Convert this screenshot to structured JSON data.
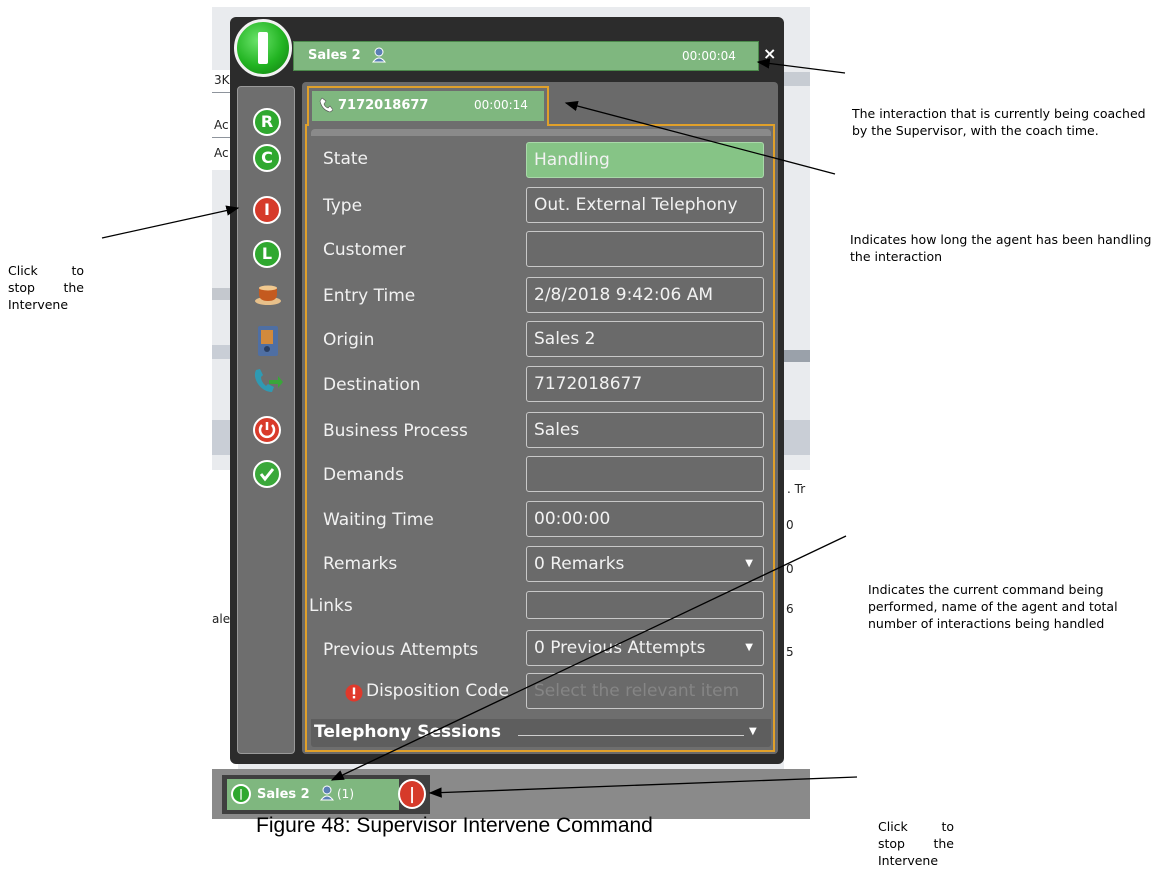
{
  "figure": {
    "caption": "Figure 48: Supervisor Intervene Command"
  },
  "header": {
    "title": "Sales 2",
    "timer": "00:00:04",
    "close_label": "×"
  },
  "interaction_tab": {
    "number": "7172018677",
    "coach_time": "00:00:14"
  },
  "side_buttons": [
    {
      "letter": "R",
      "icon": "ready-icon"
    },
    {
      "letter": "C",
      "icon": "coach-icon"
    },
    {
      "letter": "I",
      "icon": "intervene-icon"
    },
    {
      "letter": "L",
      "icon": "listen-icon"
    },
    {
      "icon": "break-cup-icon"
    },
    {
      "icon": "phone-book-icon"
    },
    {
      "icon": "transfer-phone-icon"
    },
    {
      "icon": "power-icon"
    },
    {
      "icon": "check-icon"
    }
  ],
  "fields": {
    "state": {
      "label": "State",
      "value": "Handling"
    },
    "type": {
      "label": "Type",
      "value": "Out. External Telephony"
    },
    "customer": {
      "label": "Customer",
      "value": ""
    },
    "entry_time": {
      "label": "Entry Time",
      "value": "2/8/2018 9:42:06 AM"
    },
    "origin": {
      "label": "Origin",
      "value": "Sales 2"
    },
    "destination": {
      "label": "Destination",
      "value": "7172018677"
    },
    "business_process": {
      "label": "Business Process",
      "value": "Sales"
    },
    "demands": {
      "label": "Demands",
      "value": ""
    },
    "waiting_time": {
      "label": "Waiting Time",
      "value": "00:00:00"
    },
    "remarks": {
      "label": "Remarks",
      "value": "0 Remarks"
    },
    "links": {
      "label": "Links",
      "value": ""
    },
    "previous_attempts": {
      "label": "Previous Attempts",
      "value": "0 Previous Attempts"
    },
    "disposition_code": {
      "label": "Disposition Code",
      "placeholder": "Select the relevant item"
    }
  },
  "telephony_sessions": {
    "label": "Telephony Sessions"
  },
  "bottom_bar": {
    "agent": "Sales 2",
    "count": "(1)"
  },
  "background_fragments": {
    "left_top": "3K",
    "left_row1": "Ac",
    "left_row2": "Ac",
    "left_row3": "ale",
    "right_header": ". Tr",
    "right_row1": "0",
    "right_row2": "0",
    "right_row3": "6",
    "right_row4": "5"
  },
  "annotations": {
    "coached_interaction": "The interaction that is currently being coached by the Supervisor, with the coach time.",
    "handling_duration": "Indicates how long the agent has been handling the interaction",
    "stop_intervene_left": "Click to stop the Intervene",
    "current_command": "Indicates the current command being performed, name of the agent and total number of interactions being handled",
    "stop_intervene_bottom": "Click to stop the Intervene"
  },
  "colors": {
    "accent_green": "#7fb77f",
    "state_green": "#86c486",
    "border_orange": "#e0a02a",
    "panel_gray": "#6e6e6e",
    "intervene_red": "#d63a2a"
  }
}
